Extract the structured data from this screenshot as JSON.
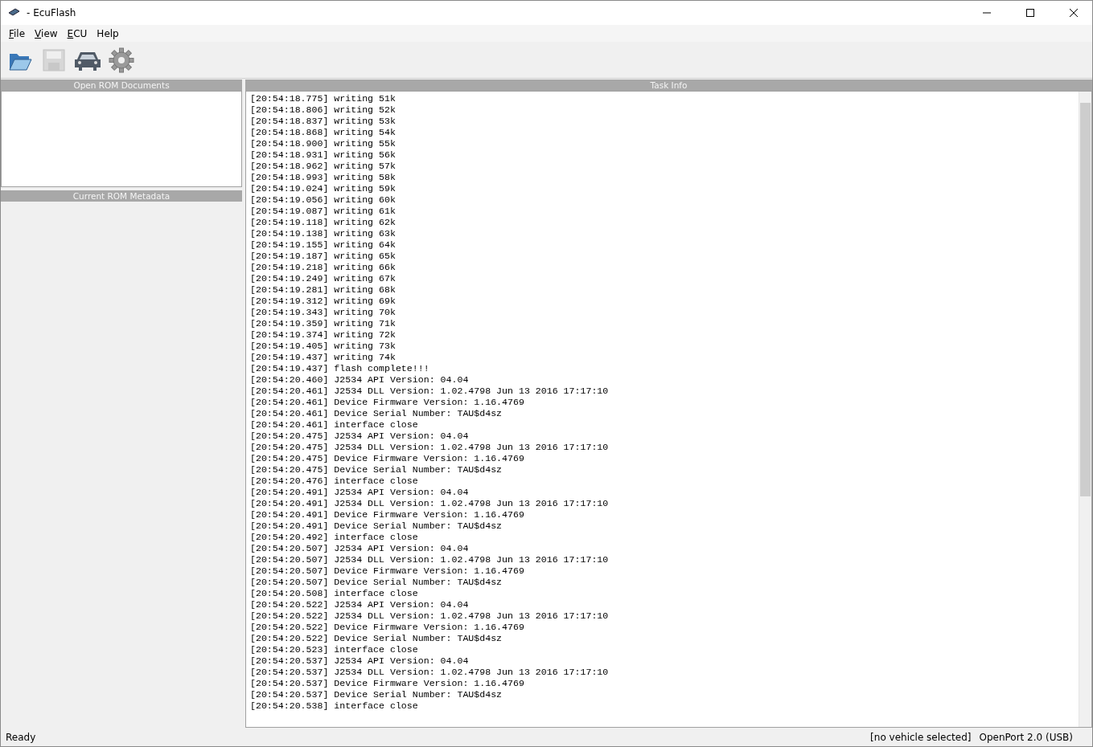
{
  "window": {
    "title": "- EcuFlash"
  },
  "menu": [
    {
      "label": "File",
      "underlined": true
    },
    {
      "label": "View",
      "underlined": true
    },
    {
      "label": "ECU",
      "underlined": true
    },
    {
      "label": "Help",
      "underlined": false
    }
  ],
  "toolbar": [
    {
      "kind": "open",
      "disabled": false
    },
    {
      "kind": "save",
      "disabled": true
    },
    {
      "kind": "vehicle",
      "disabled": false
    },
    {
      "kind": "settings",
      "disabled": false
    }
  ],
  "left_panel": {
    "documents_title": "Open ROM Documents",
    "metadata_title": "Current ROM Metadata"
  },
  "task_info": {
    "title": "Task Info",
    "lines": [
      "[20:54:18.775] writing 51k",
      "[20:54:18.806] writing 52k",
      "[20:54:18.837] writing 53k",
      "[20:54:18.868] writing 54k",
      "[20:54:18.900] writing 55k",
      "[20:54:18.931] writing 56k",
      "[20:54:18.962] writing 57k",
      "[20:54:18.993] writing 58k",
      "[20:54:19.024] writing 59k",
      "[20:54:19.056] writing 60k",
      "[20:54:19.087] writing 61k",
      "[20:54:19.118] writing 62k",
      "[20:54:19.138] writing 63k",
      "[20:54:19.155] writing 64k",
      "[20:54:19.187] writing 65k",
      "[20:54:19.218] writing 66k",
      "[20:54:19.249] writing 67k",
      "[20:54:19.281] writing 68k",
      "[20:54:19.312] writing 69k",
      "[20:54:19.343] writing 70k",
      "[20:54:19.359] writing 71k",
      "[20:54:19.374] writing 72k",
      "[20:54:19.405] writing 73k",
      "[20:54:19.437] writing 74k",
      "[20:54:19.437] flash complete!!!",
      "[20:54:20.460] J2534 API Version: 04.04",
      "[20:54:20.461] J2534 DLL Version: 1.02.4798 Jun 13 2016 17:17:10",
      "[20:54:20.461] Device Firmware Version: 1.16.4769",
      "[20:54:20.461] Device Serial Number: TAU$d4sz",
      "[20:54:20.461] interface close",
      "[20:54:20.475] J2534 API Version: 04.04",
      "[20:54:20.475] J2534 DLL Version: 1.02.4798 Jun 13 2016 17:17:10",
      "[20:54:20.475] Device Firmware Version: 1.16.4769",
      "[20:54:20.475] Device Serial Number: TAU$d4sz",
      "[20:54:20.476] interface close",
      "[20:54:20.491] J2534 API Version: 04.04",
      "[20:54:20.491] J2534 DLL Version: 1.02.4798 Jun 13 2016 17:17:10",
      "[20:54:20.491] Device Firmware Version: 1.16.4769",
      "[20:54:20.491] Device Serial Number: TAU$d4sz",
      "[20:54:20.492] interface close",
      "[20:54:20.507] J2534 API Version: 04.04",
      "[20:54:20.507] J2534 DLL Version: 1.02.4798 Jun 13 2016 17:17:10",
      "[20:54:20.507] Device Firmware Version: 1.16.4769",
      "[20:54:20.507] Device Serial Number: TAU$d4sz",
      "[20:54:20.508] interface close",
      "[20:54:20.522] J2534 API Version: 04.04",
      "[20:54:20.522] J2534 DLL Version: 1.02.4798 Jun 13 2016 17:17:10",
      "[20:54:20.522] Device Firmware Version: 1.16.4769",
      "[20:54:20.522] Device Serial Number: TAU$d4sz",
      "[20:54:20.523] interface close",
      "[20:54:20.537] J2534 API Version: 04.04",
      "[20:54:20.537] J2534 DLL Version: 1.02.4798 Jun 13 2016 17:17:10",
      "[20:54:20.537] Device Firmware Version: 1.16.4769",
      "[20:54:20.537] Device Serial Number: TAU$d4sz",
      "[20:54:20.538] interface close"
    ]
  },
  "status_bar": {
    "message": "Ready",
    "vehicle": "[no vehicle selected]",
    "interface": "OpenPort 2.0 (USB)"
  }
}
